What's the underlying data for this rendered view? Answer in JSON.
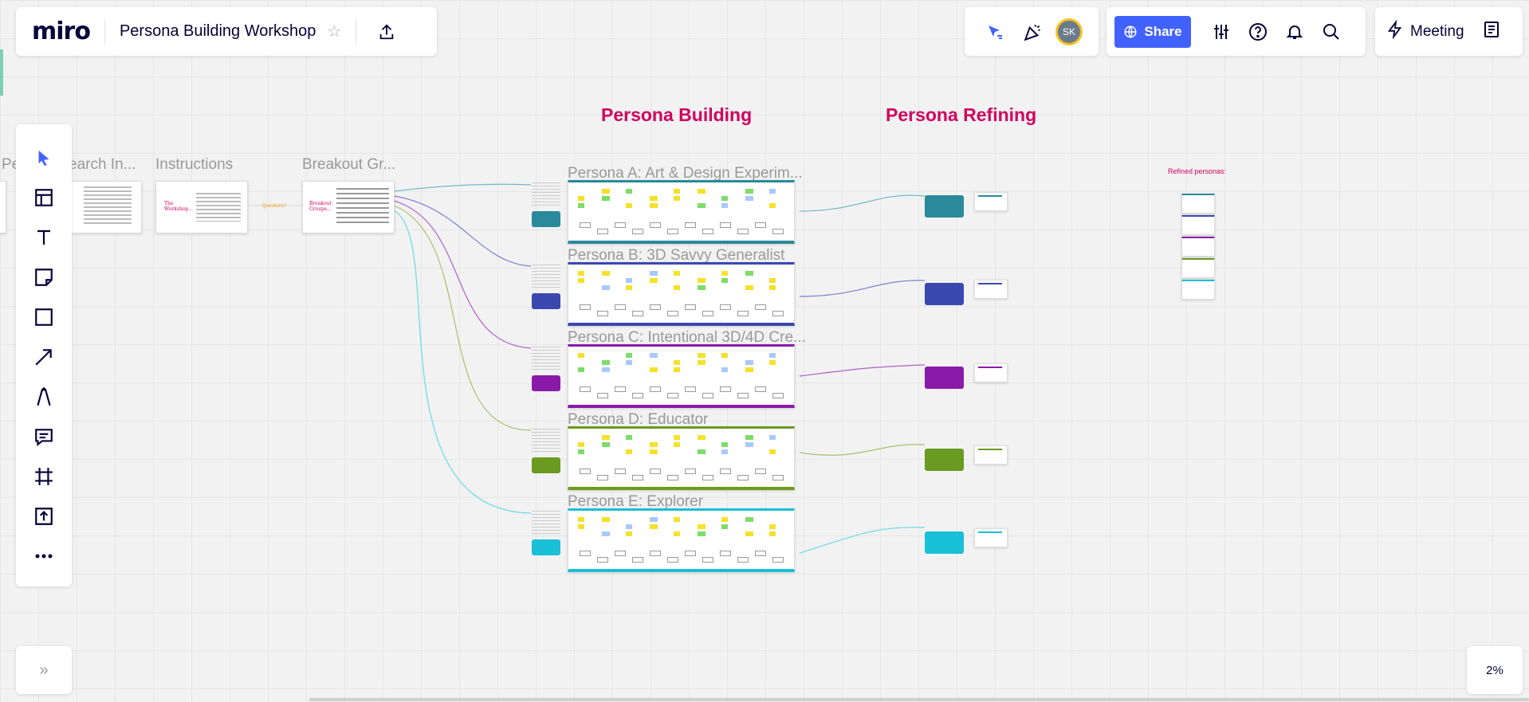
{
  "app": {
    "logo": "miro",
    "board_title": "Persona Building Workshop"
  },
  "topbar": {
    "share_label": "Share",
    "meeting_label": "Meeting",
    "avatar_initials": "SK"
  },
  "zoom": {
    "level": "2%"
  },
  "sections": {
    "building": "Persona Building",
    "refining": "Persona Refining"
  },
  "left_frames": [
    {
      "title": "Pe"
    },
    {
      "title": "earch In..."
    },
    {
      "title": "Instructions"
    },
    {
      "title": "Breakout Gr..."
    }
  ],
  "mini_texts": {
    "workshop": "The Workshop...",
    "questions": "Questions?",
    "breakout": "Breakout Groups..."
  },
  "personas": [
    {
      "title": "Persona A: Art & Design Experim...",
      "color": "#2a8a9a"
    },
    {
      "title": "Persona B: 3D Savvy Generalist",
      "color": "#3a48b0"
    },
    {
      "title": "Persona C: Intentional 3D/4D Cre...",
      "color": "#8a1aa8"
    },
    {
      "title": "Persona D: Educator",
      "color": "#6a9a20"
    },
    {
      "title": "Persona E: Explorer",
      "color": "#1ac0d8"
    }
  ],
  "refined": {
    "label": "Refined personas:"
  },
  "colors": {
    "accent": "#4262ff",
    "section": "#d1005f",
    "sticky_yellow": "#f5e12a",
    "sticky_green": "#7ddc6a",
    "sticky_blue": "#a8c8ff"
  }
}
